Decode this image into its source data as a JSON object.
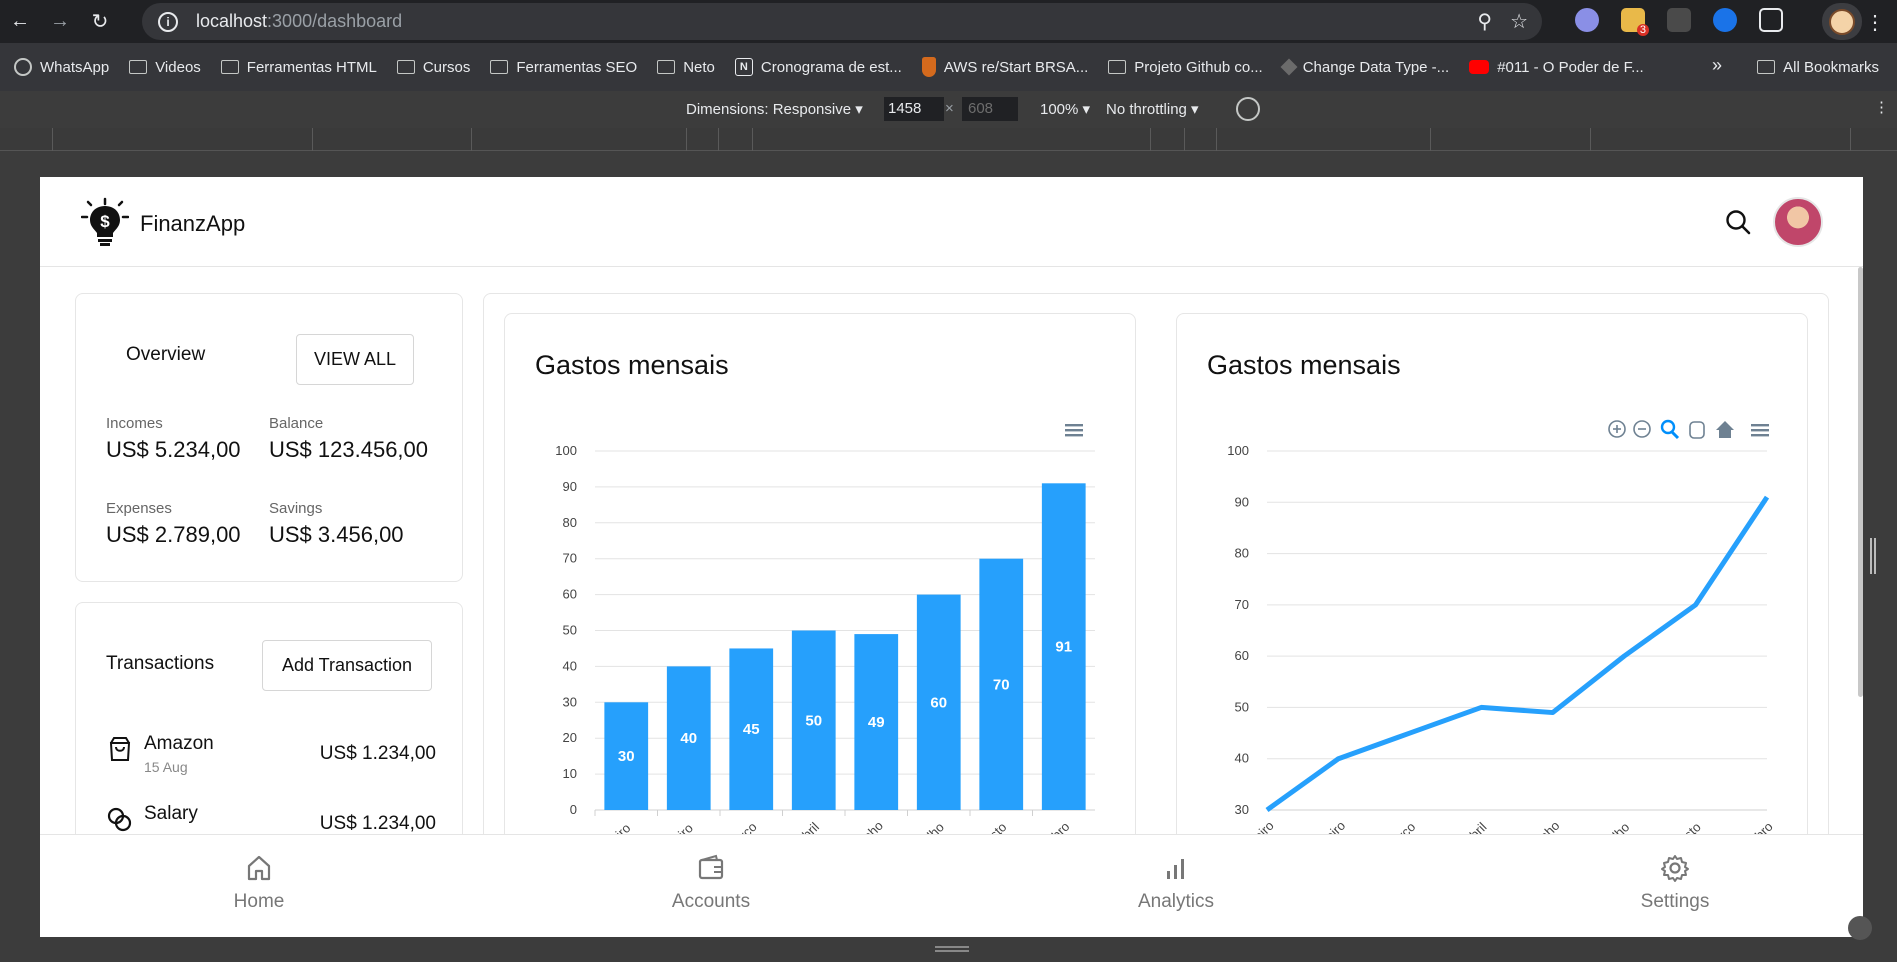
{
  "browser": {
    "url_host": "localhost",
    "url_path": ":3000/dashboard",
    "bookmarks": [
      {
        "label": "WhatsApp",
        "icon": "whatsapp-icon"
      },
      {
        "label": "Videos",
        "icon": "folder-icon"
      },
      {
        "label": "Ferramentas HTML",
        "icon": "folder-icon"
      },
      {
        "label": "Cursos",
        "icon": "folder-icon"
      },
      {
        "label": "Ferramentas SEO",
        "icon": "folder-icon"
      },
      {
        "label": "Neto",
        "icon": "folder-icon"
      },
      {
        "label": "Cronograma de est...",
        "icon": "notion-icon"
      },
      {
        "label": "AWS re/Start BRSA...",
        "icon": "aws-icon"
      },
      {
        "label": "Projeto Github co...",
        "icon": "folder-icon"
      },
      {
        "label": "Change Data Type -...",
        "icon": "diamond-icon"
      },
      {
        "label": "#011 - O Poder de F...",
        "icon": "youtube-icon"
      }
    ],
    "all_bookmarks": "All Bookmarks",
    "ext_badge": "3"
  },
  "devtools": {
    "dimensions": "Dimensions: Responsive",
    "width": "1458",
    "times": "×",
    "height": "608",
    "zoom": "100%",
    "throttling": "No throttling"
  },
  "app": {
    "brand": "FinanzApp",
    "overview": {
      "title": "Overview",
      "view_all": "VIEW ALL",
      "stats": [
        {
          "label": "Incomes",
          "value": "US$ 5.234,00"
        },
        {
          "label": "Balance",
          "value": "US$ 123.456,00"
        },
        {
          "label": "Expenses",
          "value": "US$ 2.789,00"
        },
        {
          "label": "Savings",
          "value": "US$ 3.456,00"
        }
      ]
    },
    "transactions": {
      "title": "Transactions",
      "add_label": "Add Transaction",
      "items": [
        {
          "name": "Amazon",
          "date": "15 Aug",
          "amount": "US$ 1.234,00",
          "icon": "shopping-bag-icon"
        },
        {
          "name": "Salary",
          "date": "",
          "amount": "US$ 1.234,00",
          "icon": "coins-icon"
        }
      ]
    },
    "nav": [
      {
        "label": "Home",
        "icon": "home-icon"
      },
      {
        "label": "Accounts",
        "icon": "wallet-icon"
      },
      {
        "label": "Analytics",
        "icon": "bar-chart-icon"
      },
      {
        "label": "Settings",
        "icon": "gear-icon"
      }
    ]
  },
  "chart_data": [
    {
      "type": "bar",
      "title": "Gastos mensais",
      "categories": [
        "iro",
        "iro",
        "rco",
        "bril",
        "aho",
        "lho",
        "sto",
        "bro"
      ],
      "values": [
        30,
        40,
        45,
        50,
        49,
        60,
        70,
        91
      ],
      "ylim": [
        0,
        100
      ],
      "yticks": [
        0,
        10,
        20,
        30,
        40,
        50,
        60,
        70,
        80,
        90,
        100
      ],
      "color": "#26a0fc",
      "grid": true,
      "data_labels": true,
      "toolbar": [
        "menu-icon"
      ]
    },
    {
      "type": "line",
      "title": "Gastos mensais",
      "categories": [
        "eiro",
        "eiro",
        "rco",
        "bril",
        "aho",
        "lho",
        "sto",
        "bro"
      ],
      "values": [
        30,
        40,
        45,
        50,
        49,
        60,
        70,
        91
      ],
      "ylim": [
        30,
        100
      ],
      "yticks": [
        30,
        40,
        50,
        60,
        70,
        80,
        90,
        100
      ],
      "color": "#26a0fc",
      "grid": true,
      "toolbar": [
        "zoom-in-icon",
        "zoom-out-icon",
        "magnifier-icon",
        "pan-hand-icon",
        "home-reset-icon",
        "menu-icon"
      ]
    }
  ]
}
